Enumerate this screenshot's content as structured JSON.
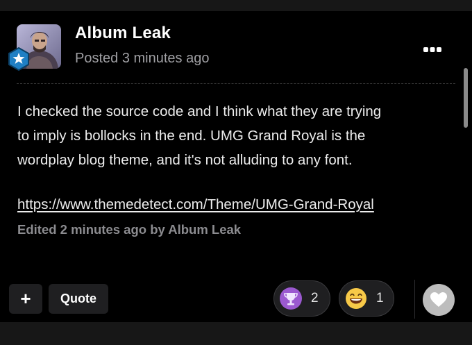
{
  "post": {
    "author": "Album Leak",
    "posted": "Posted 3 minutes ago",
    "body": [
      "I checked the source code and I think what they are trying",
      "to imply is bollocks in the end. UMG Grand Royal is the",
      "wordplay blog theme, and it's not alluding to any font."
    ],
    "link": "https://www.themedetect.com/Theme/UMG-Grand-Royal",
    "edited": "Edited 2 minutes ago by Album Leak"
  },
  "actions": {
    "plus_label": "+",
    "quote_label": "Quote"
  },
  "reactions": [
    {
      "icon": "trophy-icon",
      "count": "2",
      "color": "#9b59d0"
    },
    {
      "icon": "grin-emoji-icon",
      "count": "1",
      "color": "#f5c518"
    }
  ],
  "icons": {
    "menu": "more-options-icon",
    "like": "heart-icon",
    "badge": "star-badge-icon"
  },
  "colors": {
    "background": "#000000",
    "surface": "#1f1f21",
    "muted_text": "#a0a0a4",
    "badge_blue": "#2b8fd6"
  }
}
